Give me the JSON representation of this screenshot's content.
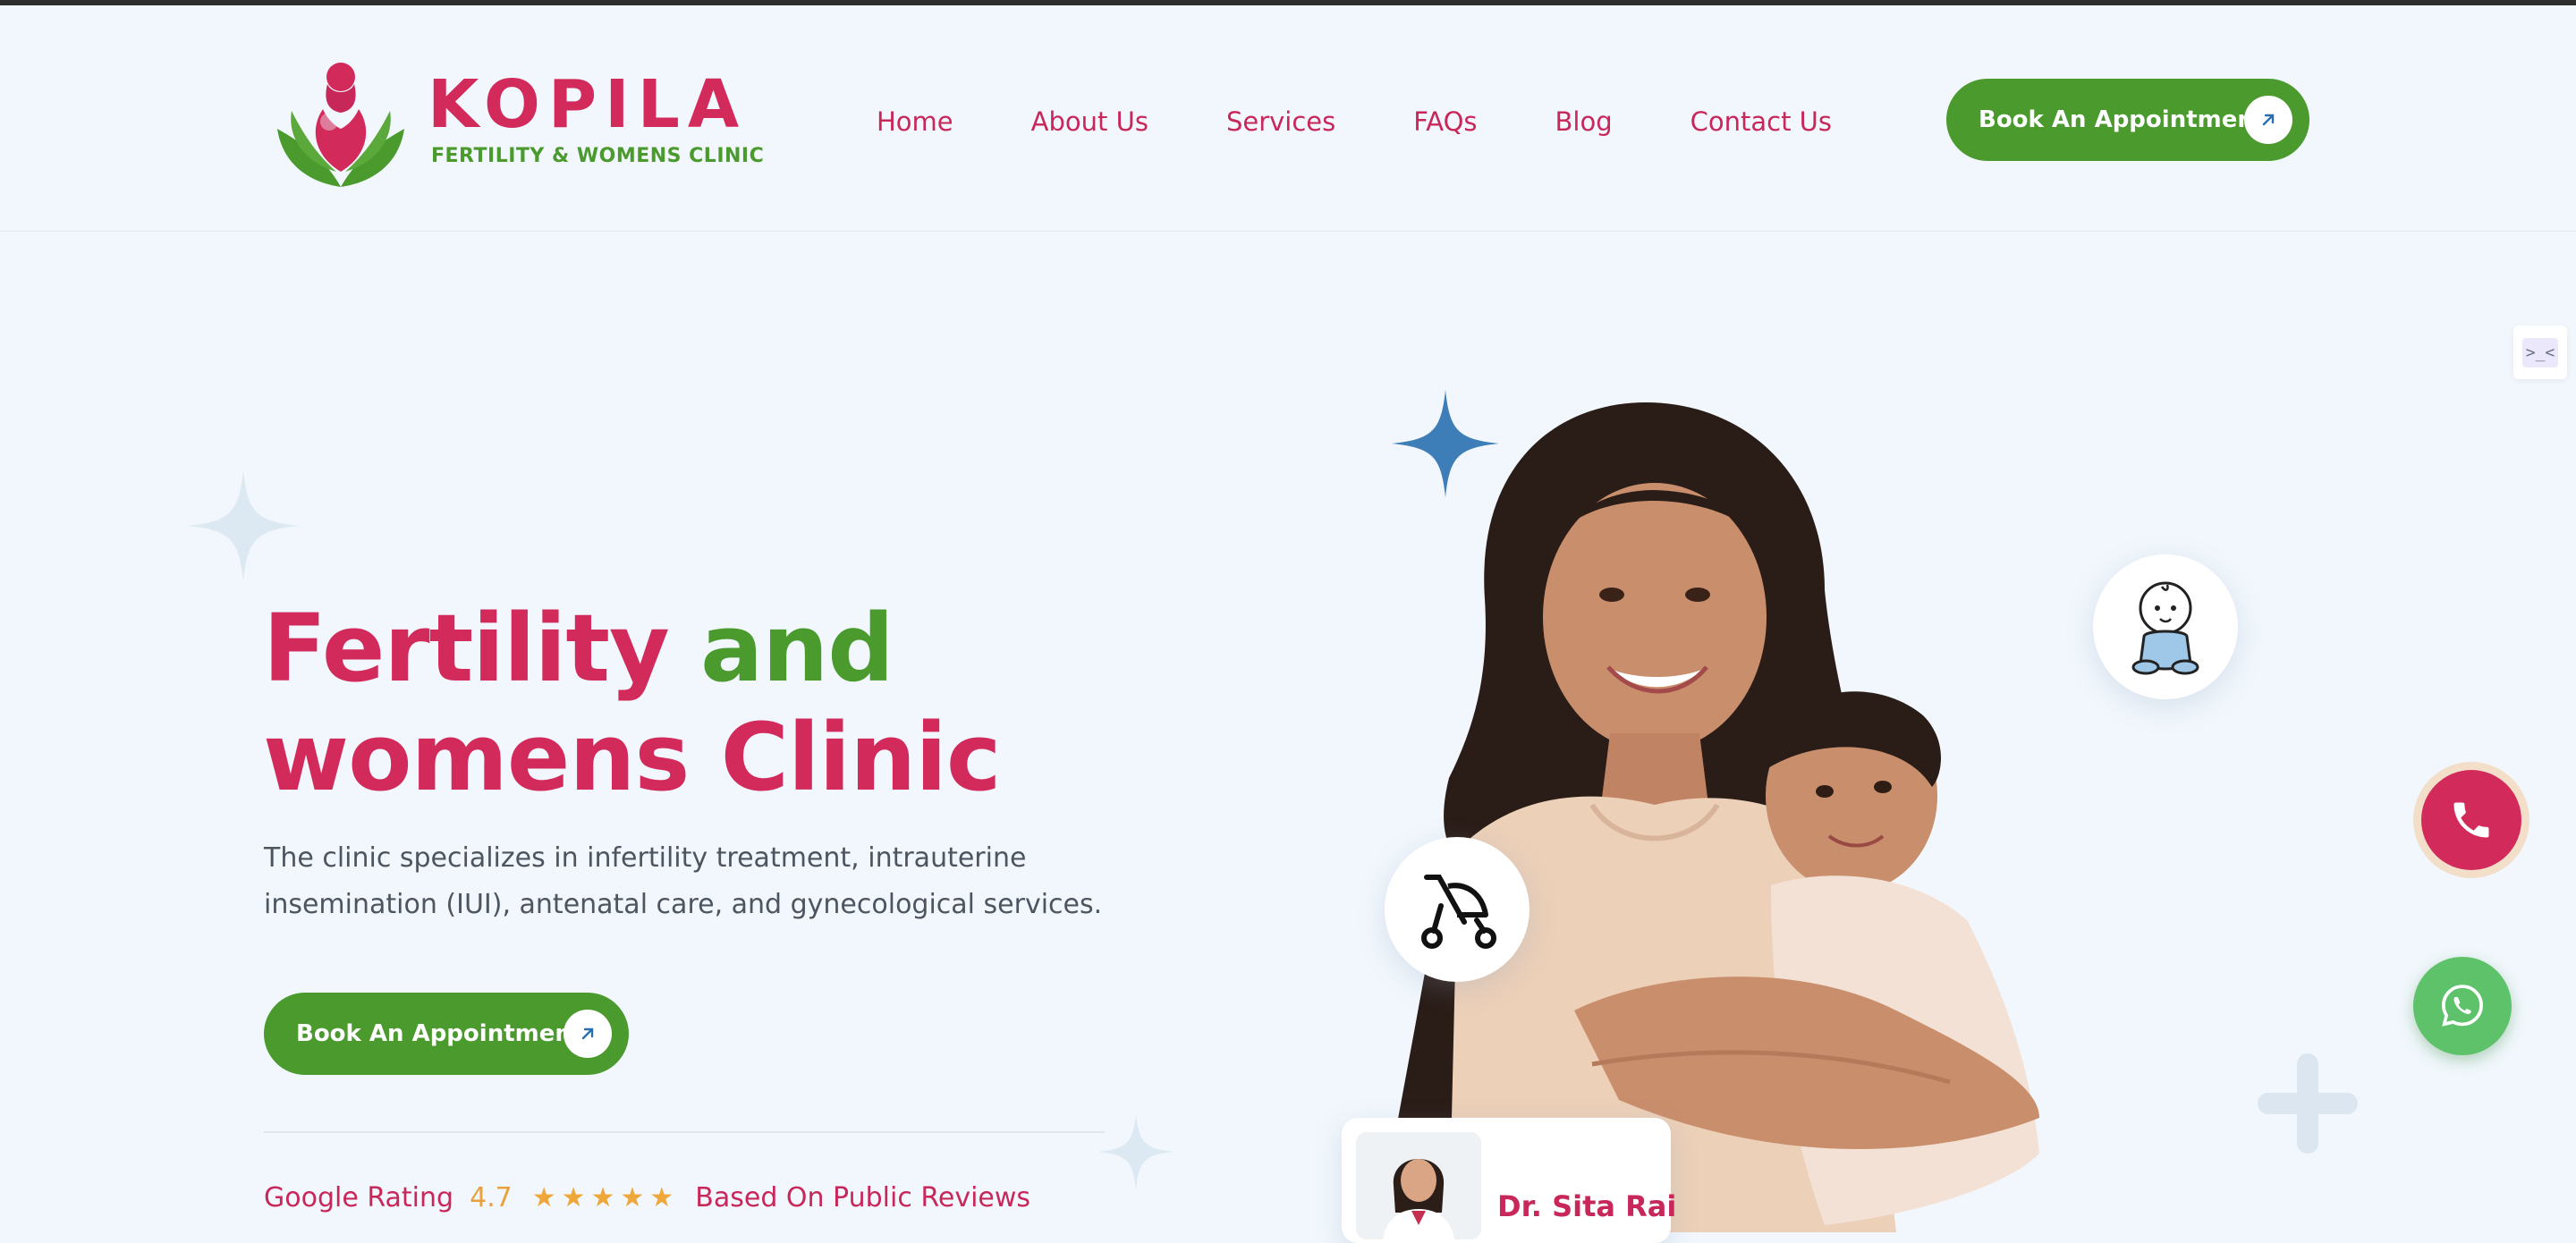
{
  "brand": {
    "name": "KOPILA",
    "tagline": "FERTILITY & WOMENS CLINIC"
  },
  "nav": {
    "items": [
      "Home",
      "About Us",
      "Services",
      "FAQs",
      "Blog",
      "Contact Us"
    ],
    "cta_label": "Book An Appointment"
  },
  "hero": {
    "title_part1": "Fertility",
    "title_part2": "and",
    "title_part3": "womens Clinic",
    "description": "The clinic specializes in infertility treatment, intrauterine insemination (IUI), antenatal care, and gynecological services.",
    "cta_label": "Book An Appointment"
  },
  "rating": {
    "label": "Google Rating",
    "value": "4.7",
    "stars": "★★★★★",
    "star_count": 5,
    "note": "Based On Public Reviews"
  },
  "doctor": {
    "name": "Dr. Sita Rai"
  },
  "side_widget": {
    "text": ">_<"
  },
  "icons": {
    "arrow": "arrow-up-right-icon",
    "baby": "baby-icon",
    "stroller": "stroller-icon",
    "phone": "phone-icon",
    "whatsapp": "whatsapp-icon"
  },
  "colors": {
    "brand_pink": "#d22b5b",
    "brand_green": "#4a9a2e",
    "background": "#f1f7fc",
    "star": "#f0a73a",
    "whatsapp": "#5ec26a"
  }
}
